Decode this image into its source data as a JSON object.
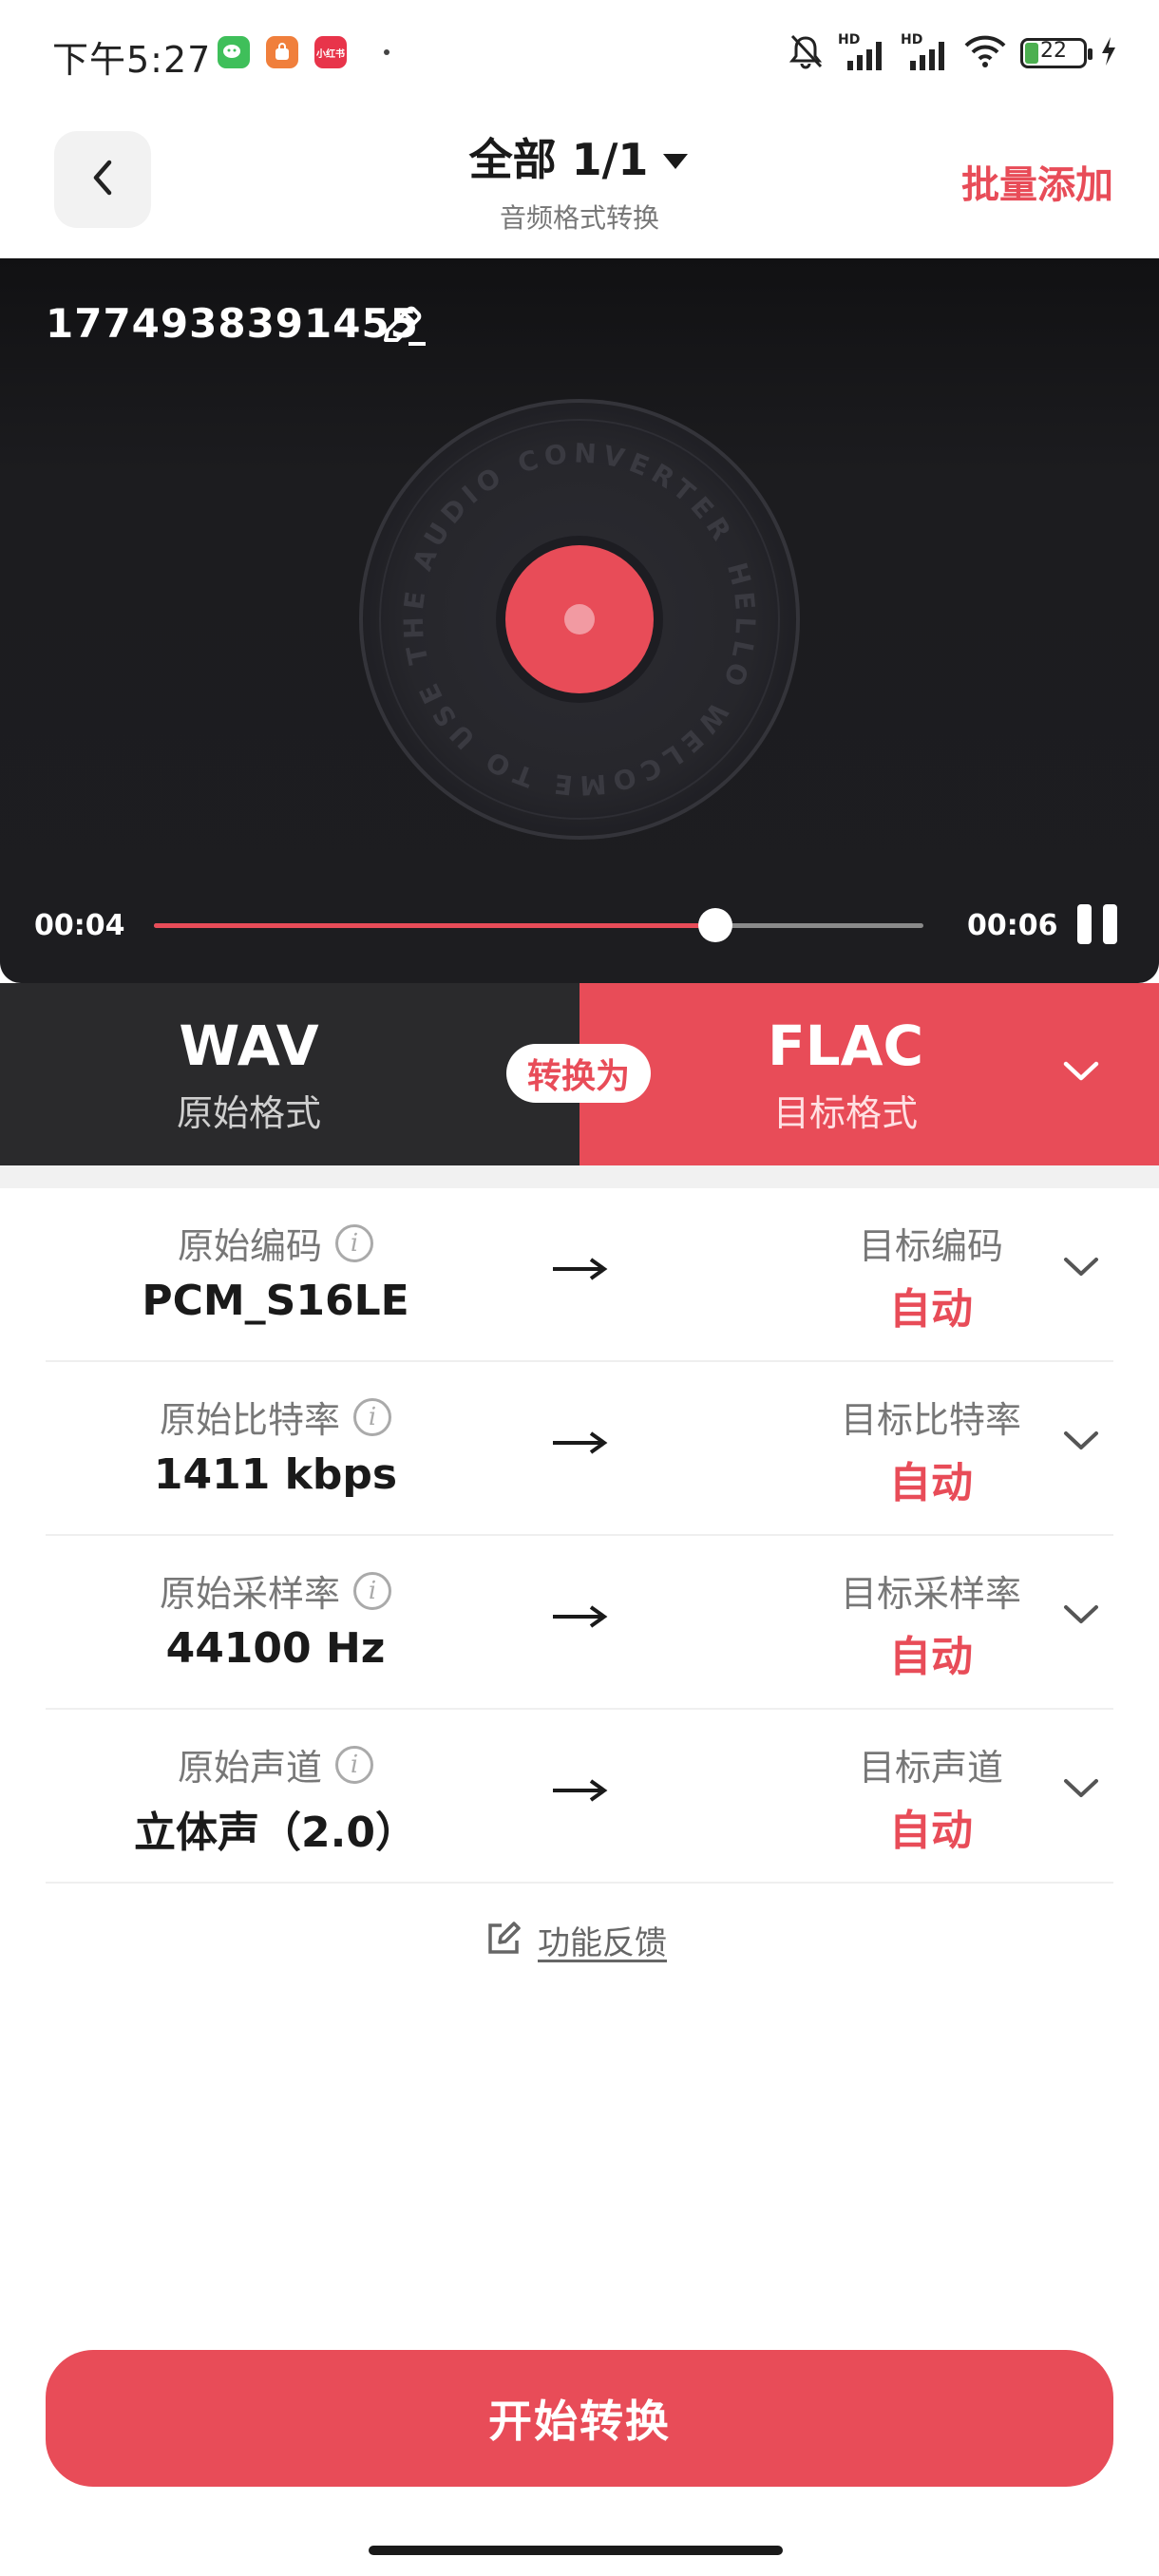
{
  "status_bar": {
    "time": "下午5:27",
    "app_icon_3_text": "小红书",
    "battery": "22"
  },
  "header": {
    "title": "全部 1/1",
    "subtitle": "音频格式转换",
    "batch_add": "批量添加"
  },
  "player": {
    "file_name": "1774938391455",
    "current_time": "00:04",
    "total_time": "00:06",
    "progress": 0.73,
    "record_text": "HELLO WELCOME TO USE THE AUDIO CONVERTER"
  },
  "formats": {
    "source_format": "WAV",
    "source_label": "原始格式",
    "convert_label": "转换为",
    "target_format": "FLAC",
    "target_label": "目标格式"
  },
  "params": [
    {
      "src_label": "原始编码",
      "src_value": "PCM_S16LE",
      "dst_label": "目标编码",
      "dst_value": "自动"
    },
    {
      "src_label": "原始比特率",
      "src_value": "1411 kbps",
      "dst_label": "目标比特率",
      "dst_value": "自动"
    },
    {
      "src_label": "原始采样率",
      "src_value": "44100 Hz",
      "dst_label": "目标采样率",
      "dst_value": "自动"
    },
    {
      "src_label": "原始声道",
      "src_value": "立体声（2.0）",
      "dst_label": "目标声道",
      "dst_value": "自动"
    }
  ],
  "feedback": "功能反馈",
  "start_button": "开始转换",
  "colors": {
    "accent": "#e84c58",
    "dark_panel": "#2a2a2c"
  }
}
